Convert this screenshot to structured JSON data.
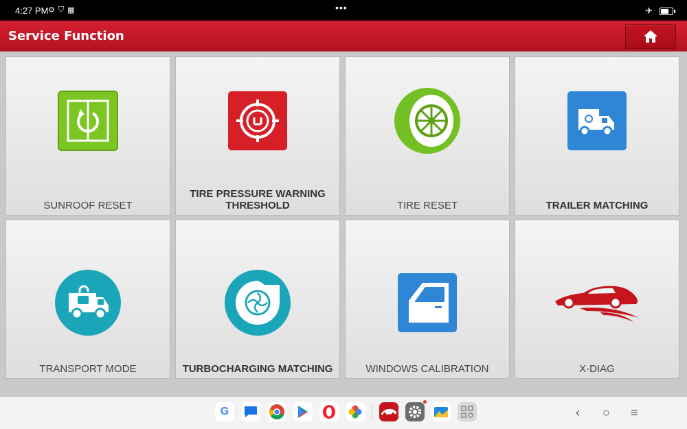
{
  "status": {
    "time": "4:27 PM",
    "left_icons": [
      "settings-small-icon",
      "shield-icon",
      "grid-small-icon"
    ],
    "center_dots": "•••",
    "right_icons": [
      "airplane-icon",
      "battery-icon"
    ]
  },
  "header": {
    "title": "Service Function",
    "home_icon": "home-icon"
  },
  "tiles": [
    {
      "label": "SUNROOF RESET",
      "icon": "sunroof-icon",
      "color": "#7cc624"
    },
    {
      "label": "TIRE PRESSURE WARNING THRESHOLD",
      "icon": "tpms-icon",
      "color": "#d71f27"
    },
    {
      "label": "TIRE RESET",
      "icon": "tire-icon",
      "color": "#72c023"
    },
    {
      "label": "TRAILER MATCHING",
      "icon": "truck-icon",
      "color": "#2f86d6"
    },
    {
      "label": "TRANSPORT MODE",
      "icon": "transport-van-icon",
      "color": "#1aa6b8"
    },
    {
      "label": "TURBOCHARGING MATCHING",
      "icon": "turbo-icon",
      "color": "#1aa6b8"
    },
    {
      "label": "WINDOWS CALIBRATION",
      "icon": "car-door-icon",
      "color": "#2f86d6"
    },
    {
      "label": "X-DIAG",
      "icon": "red-car-icon",
      "color": "#c4161c"
    }
  ],
  "dock_apps": [
    "google-icon",
    "messages-icon",
    "chrome-icon",
    "play-store-icon",
    "opera-icon",
    "photos-icon",
    "diag-app-icon",
    "settings-icon",
    "gallery-icon",
    "app-drawer-icon"
  ],
  "nav": {
    "back": "‹",
    "home": "○",
    "menu": "≡"
  }
}
